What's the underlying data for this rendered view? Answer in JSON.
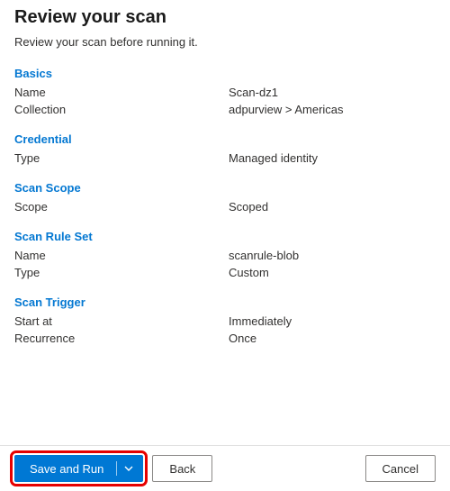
{
  "header": {
    "title": "Review your scan",
    "subtitle": "Review your scan before running it."
  },
  "sections": {
    "basics": {
      "heading": "Basics",
      "name_label": "Name",
      "name_value": "Scan-dz1",
      "collection_label": "Collection",
      "collection_value": "adpurview > Americas"
    },
    "credential": {
      "heading": "Credential",
      "type_label": "Type",
      "type_value": "Managed identity"
    },
    "scope": {
      "heading": "Scan Scope",
      "scope_label": "Scope",
      "scope_value": "Scoped"
    },
    "ruleset": {
      "heading": "Scan Rule Set",
      "name_label": "Name",
      "name_value": "scanrule-blob",
      "type_label": "Type",
      "type_value": "Custom"
    },
    "trigger": {
      "heading": "Scan Trigger",
      "start_label": "Start at",
      "start_value": "Immediately",
      "recurrence_label": "Recurrence",
      "recurrence_value": "Once"
    }
  },
  "footer": {
    "save_and_run": "Save and Run",
    "back": "Back",
    "cancel": "Cancel"
  },
  "colors": {
    "accent_link": "#0478d2",
    "primary": "#0078d4",
    "highlight_outline": "#e60000"
  }
}
